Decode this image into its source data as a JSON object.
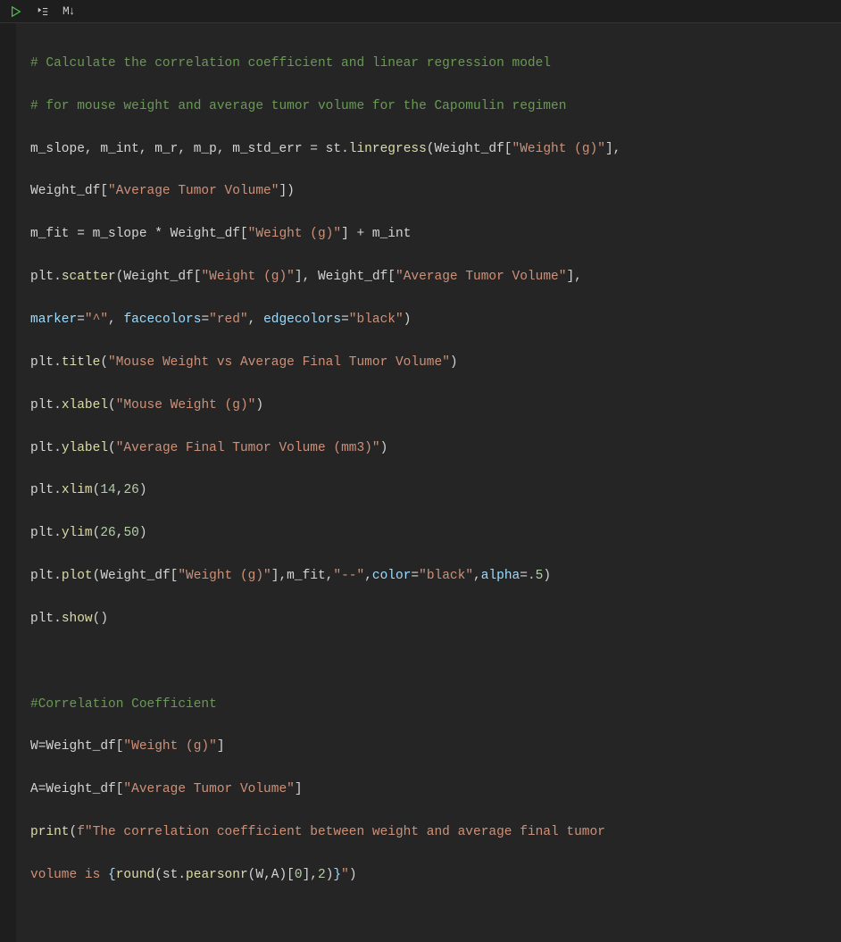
{
  "toolbar": {
    "run_icon": "run-icon",
    "run_by_line_icon": "run-by-line-icon",
    "markdown_icon_label": "M↓"
  },
  "code": {
    "l1": "# Calculate the correlation coefficient and linear regression model",
    "l2": "# for mouse weight and average tumor volume for the Capomulin regimen",
    "l3": {
      "a": "m_slope, m_int, m_r, m_p, m_std_err ",
      "eq": "=",
      "b": " st.",
      "fn": "linregress",
      "p1": "(Weight_df[",
      "s1": "\"Weight (g)\"",
      "p2": "],"
    },
    "l4": {
      "a": "Weight_df[",
      "s1": "\"Average Tumor Volume\"",
      "b": "])"
    },
    "l5": {
      "a": "m_fit ",
      "eq": "=",
      "b": " m_slope ",
      "op2": "*",
      "c": " Weight_df[",
      "s1": "\"Weight (g)\"",
      "d": "] ",
      "op3": "+",
      "e": " m_int"
    },
    "l6": {
      "a": "plt.",
      "fn": "scatter",
      "b": "(Weight_df[",
      "s1": "\"Weight (g)\"",
      "c": "], Weight_df[",
      "s2": "\"Average Tumor Volume\"",
      "d": "],"
    },
    "l7": {
      "k1": "marker",
      "eq1": "=",
      "s1": "\"^\"",
      "c1": ", ",
      "k2": "facecolors",
      "eq2": "=",
      "s2": "\"red\"",
      "c2": ", ",
      "k3": "edgecolors",
      "eq3": "=",
      "s3": "\"black\"",
      "p": ")"
    },
    "l8": {
      "a": "plt.",
      "fn": "title",
      "b": "(",
      "s1": "\"Mouse Weight vs Average Final Tumor Volume\"",
      "c": ")"
    },
    "l9": {
      "a": "plt.",
      "fn": "xlabel",
      "b": "(",
      "s1": "\"Mouse Weight (g)\"",
      "c": ")"
    },
    "l10": {
      "a": "plt.",
      "fn": "ylabel",
      "b": "(",
      "s1": "\"Average Final Tumor Volume (mm3)\"",
      "c": ")"
    },
    "l11": {
      "a": "plt.",
      "fn": "xlim",
      "b": "(",
      "n1": "14",
      "c": ",",
      "n2": "26",
      "d": ")"
    },
    "l12": {
      "a": "plt.",
      "fn": "ylim",
      "b": "(",
      "n1": "26",
      "c": ",",
      "n2": "50",
      "d": ")"
    },
    "l13": {
      "a": "plt.",
      "fn": "plot",
      "b": "(Weight_df[",
      "s1": "\"Weight (g)\"",
      "c": "],m_fit,",
      "s2": "\"--\"",
      "d": ",",
      "k1": "color",
      "eq1": "=",
      "s3": "\"black\"",
      "e": ",",
      "k2": "alpha",
      "eq2": "=",
      "n1": ".5",
      "f": ")"
    },
    "l14": {
      "a": "plt.",
      "fn": "show",
      "b": "()"
    },
    "l15": "",
    "l16": "#Correlation Coefficient",
    "l17": {
      "a": "W",
      "eq": "=",
      "b": "Weight_df[",
      "s1": "\"Weight (g)\"",
      "c": "]"
    },
    "l18": {
      "a": "A",
      "eq": "=",
      "b": "Weight_df[",
      "s1": "\"Average Tumor Volume\"",
      "c": "]"
    },
    "l19": {
      "fn": "print",
      "a": "(",
      "fpre": "f\"The correlation coefficient between weight and average final tumor "
    },
    "l20": {
      "s1": "volume is ",
      "br1": "{",
      "fn": "round",
      "a": "(st.",
      "fn2": "pearsonr",
      "b": "(W,A)[",
      "n1": "0",
      "c": "],",
      "n2": "2",
      "d": ")",
      "br2": "}",
      "s2": "\"",
      "e": ")"
    }
  }
}
